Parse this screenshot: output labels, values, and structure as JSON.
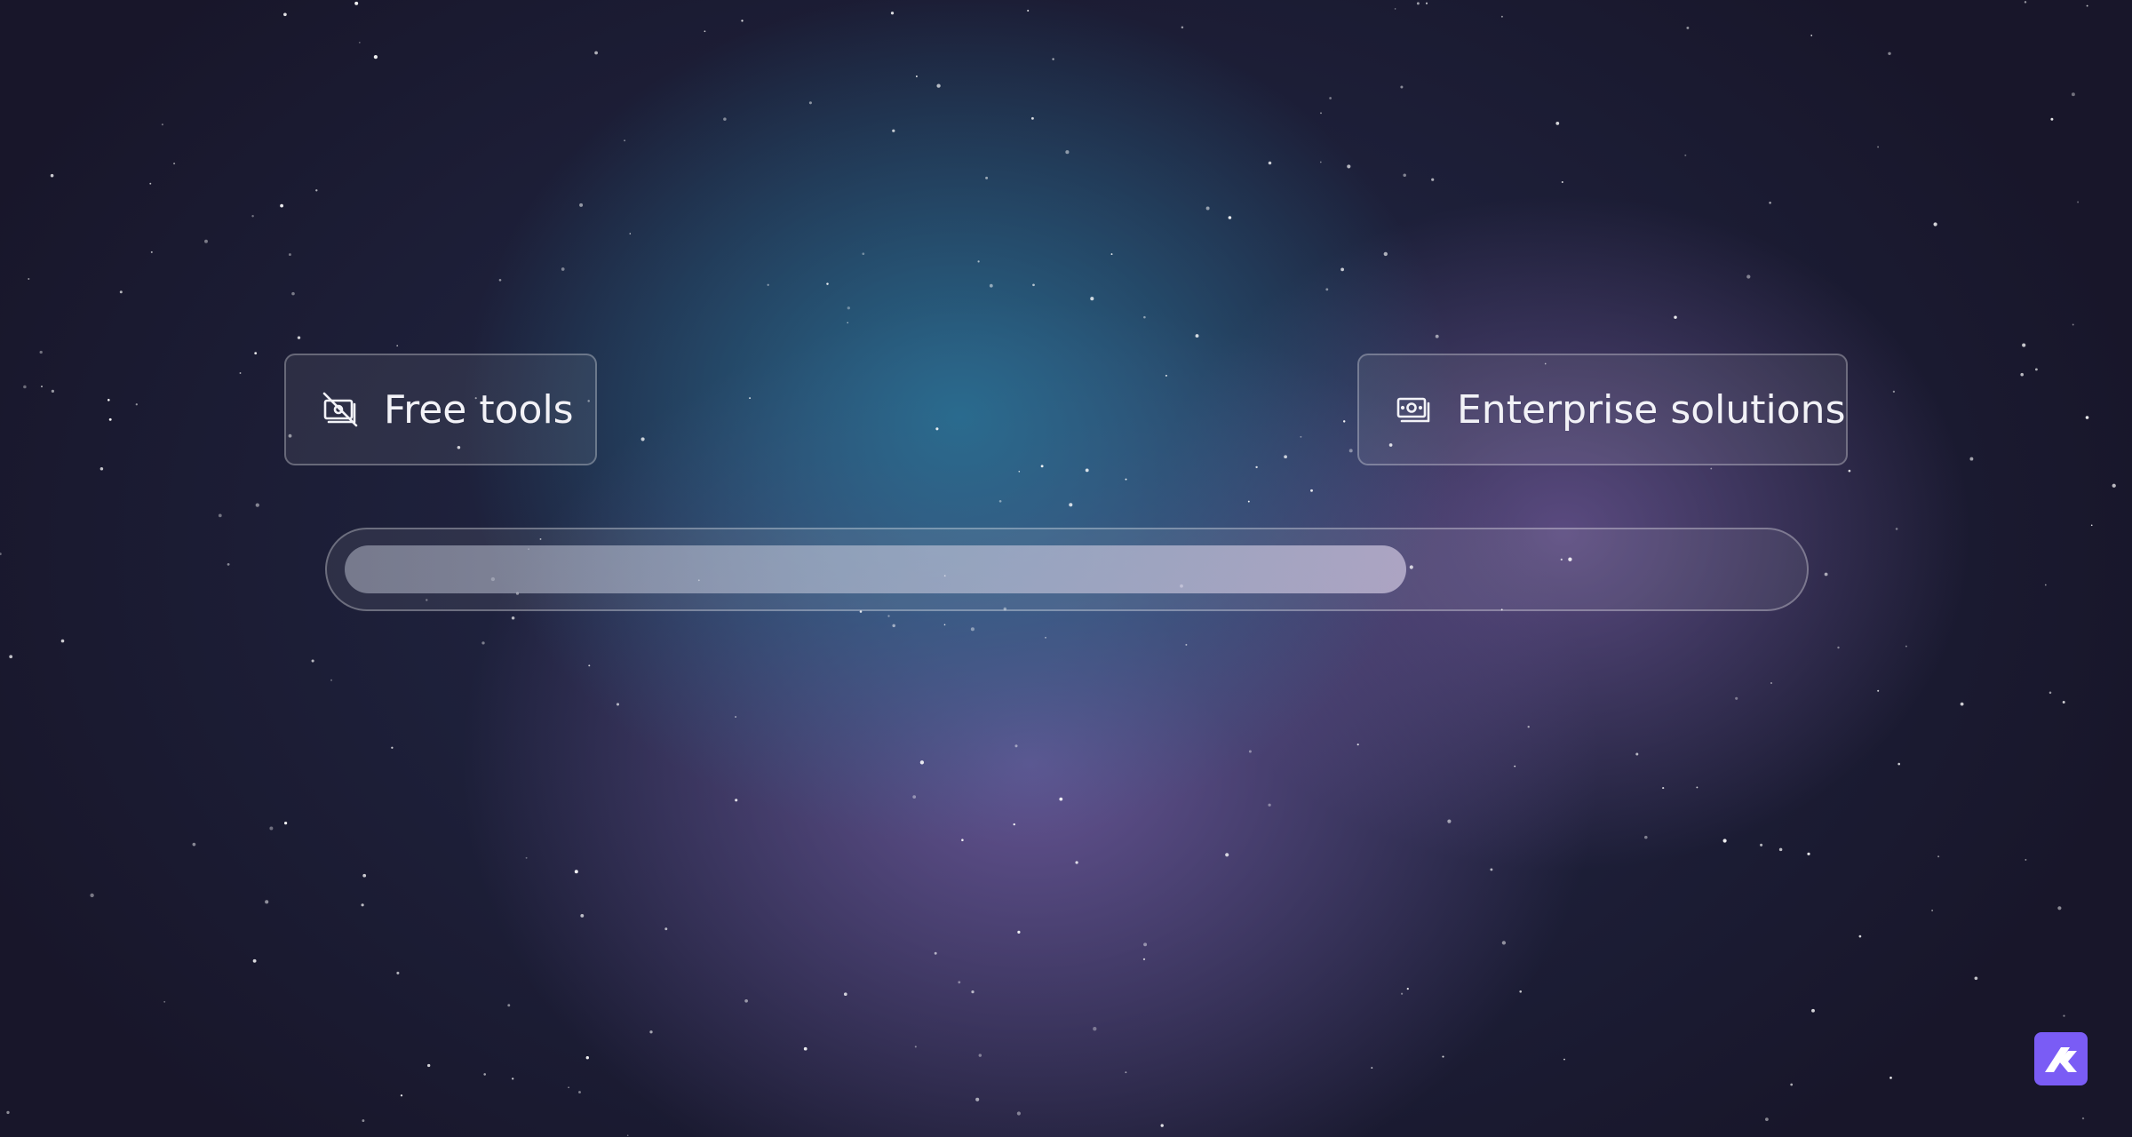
{
  "labels": {
    "free": {
      "text": "Free tools",
      "icon": "money-off-icon"
    },
    "enterprise": {
      "text": "Enterprise solutions",
      "icon": "money-icon"
    }
  },
  "slider": {
    "value": 0.735
  },
  "logo": {
    "icon": "brand-logo-icon",
    "color": "#7a5cf5"
  }
}
